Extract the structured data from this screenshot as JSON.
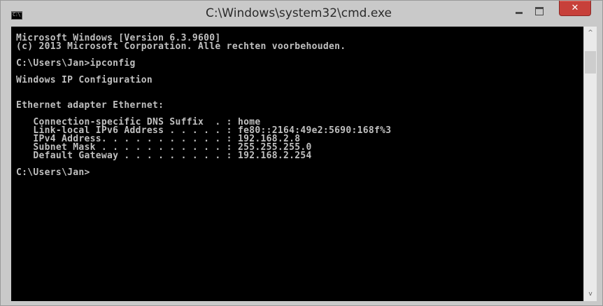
{
  "window": {
    "title": "C:\\Windows\\system32\\cmd.exe",
    "icon_name": "cmd-icon",
    "icon_text": "C:\\",
    "controls": {
      "minimize_icon": "minimize-icon",
      "maximize_icon": "maximize-icon",
      "close_icon": "close-icon",
      "close_glyph": "✕",
      "close_color": "#c7403a"
    }
  },
  "console": {
    "background": "#000000",
    "foreground": "#c0c0c0",
    "lines": [
      "Microsoft Windows [Version 6.3.9600]",
      "(c) 2013 Microsoft Corporation. Alle rechten voorbehouden.",
      "",
      "C:\\Users\\Jan>ipconfig",
      "",
      "Windows IP Configuration",
      "",
      "",
      "Ethernet adapter Ethernet:",
      "",
      "   Connection-specific DNS Suffix  . : home",
      "   Link-local IPv6 Address . . . . . : fe80::2164:49e2:5690:168f%3",
      "   IPv4 Address. . . . . . . . . . . : 192.168.2.8",
      "   Subnet Mask . . . . . . . . . . . : 255.255.255.0",
      "   Default Gateway . . . . . . . . . : 192.168.2.254",
      "",
      "C:\\Users\\Jan>"
    ]
  },
  "scrollbar": {
    "up_arrow": "^",
    "down_arrow": "v",
    "up_icon": "scroll-up-arrow-icon",
    "down_icon": "scroll-down-arrow-icon"
  }
}
